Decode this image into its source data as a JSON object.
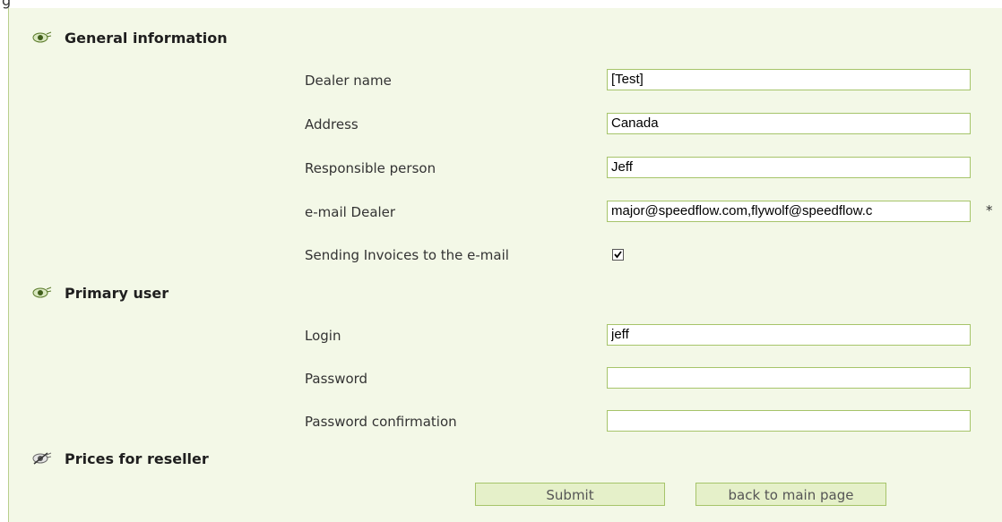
{
  "page_top_cut_text": "g",
  "sections": {
    "general": {
      "title": "General information",
      "icon": "eye-icon"
    },
    "primary_user": {
      "title": "Primary user",
      "icon": "eye-icon"
    },
    "prices": {
      "title": "Prices for reseller",
      "icon": "eye-slash-icon"
    }
  },
  "fields": {
    "dealer_name": {
      "label": "Dealer name",
      "value": "[Test]"
    },
    "address": {
      "label": "Address",
      "value": "Canada"
    },
    "responsible_person": {
      "label": "Responsible person",
      "value": "Jeff"
    },
    "email_dealer": {
      "label": "e-mail Dealer",
      "value": "major@speedflow.com,flywolf@speedflow.c",
      "required_mark": "*"
    },
    "send_invoices": {
      "label": "Sending Invoices to the e-mail",
      "checked": true
    },
    "login": {
      "label": "Login",
      "value": "jeff"
    },
    "password": {
      "label": "Password",
      "value": ""
    },
    "password_confirmation": {
      "label": "Password confirmation",
      "value": ""
    }
  },
  "buttons": {
    "submit": "Submit",
    "back": "back to main page"
  },
  "colors": {
    "panel_bg": "#f3f8e7",
    "input_border": "#a6c46a",
    "button_bg": "#e5f0c9"
  }
}
